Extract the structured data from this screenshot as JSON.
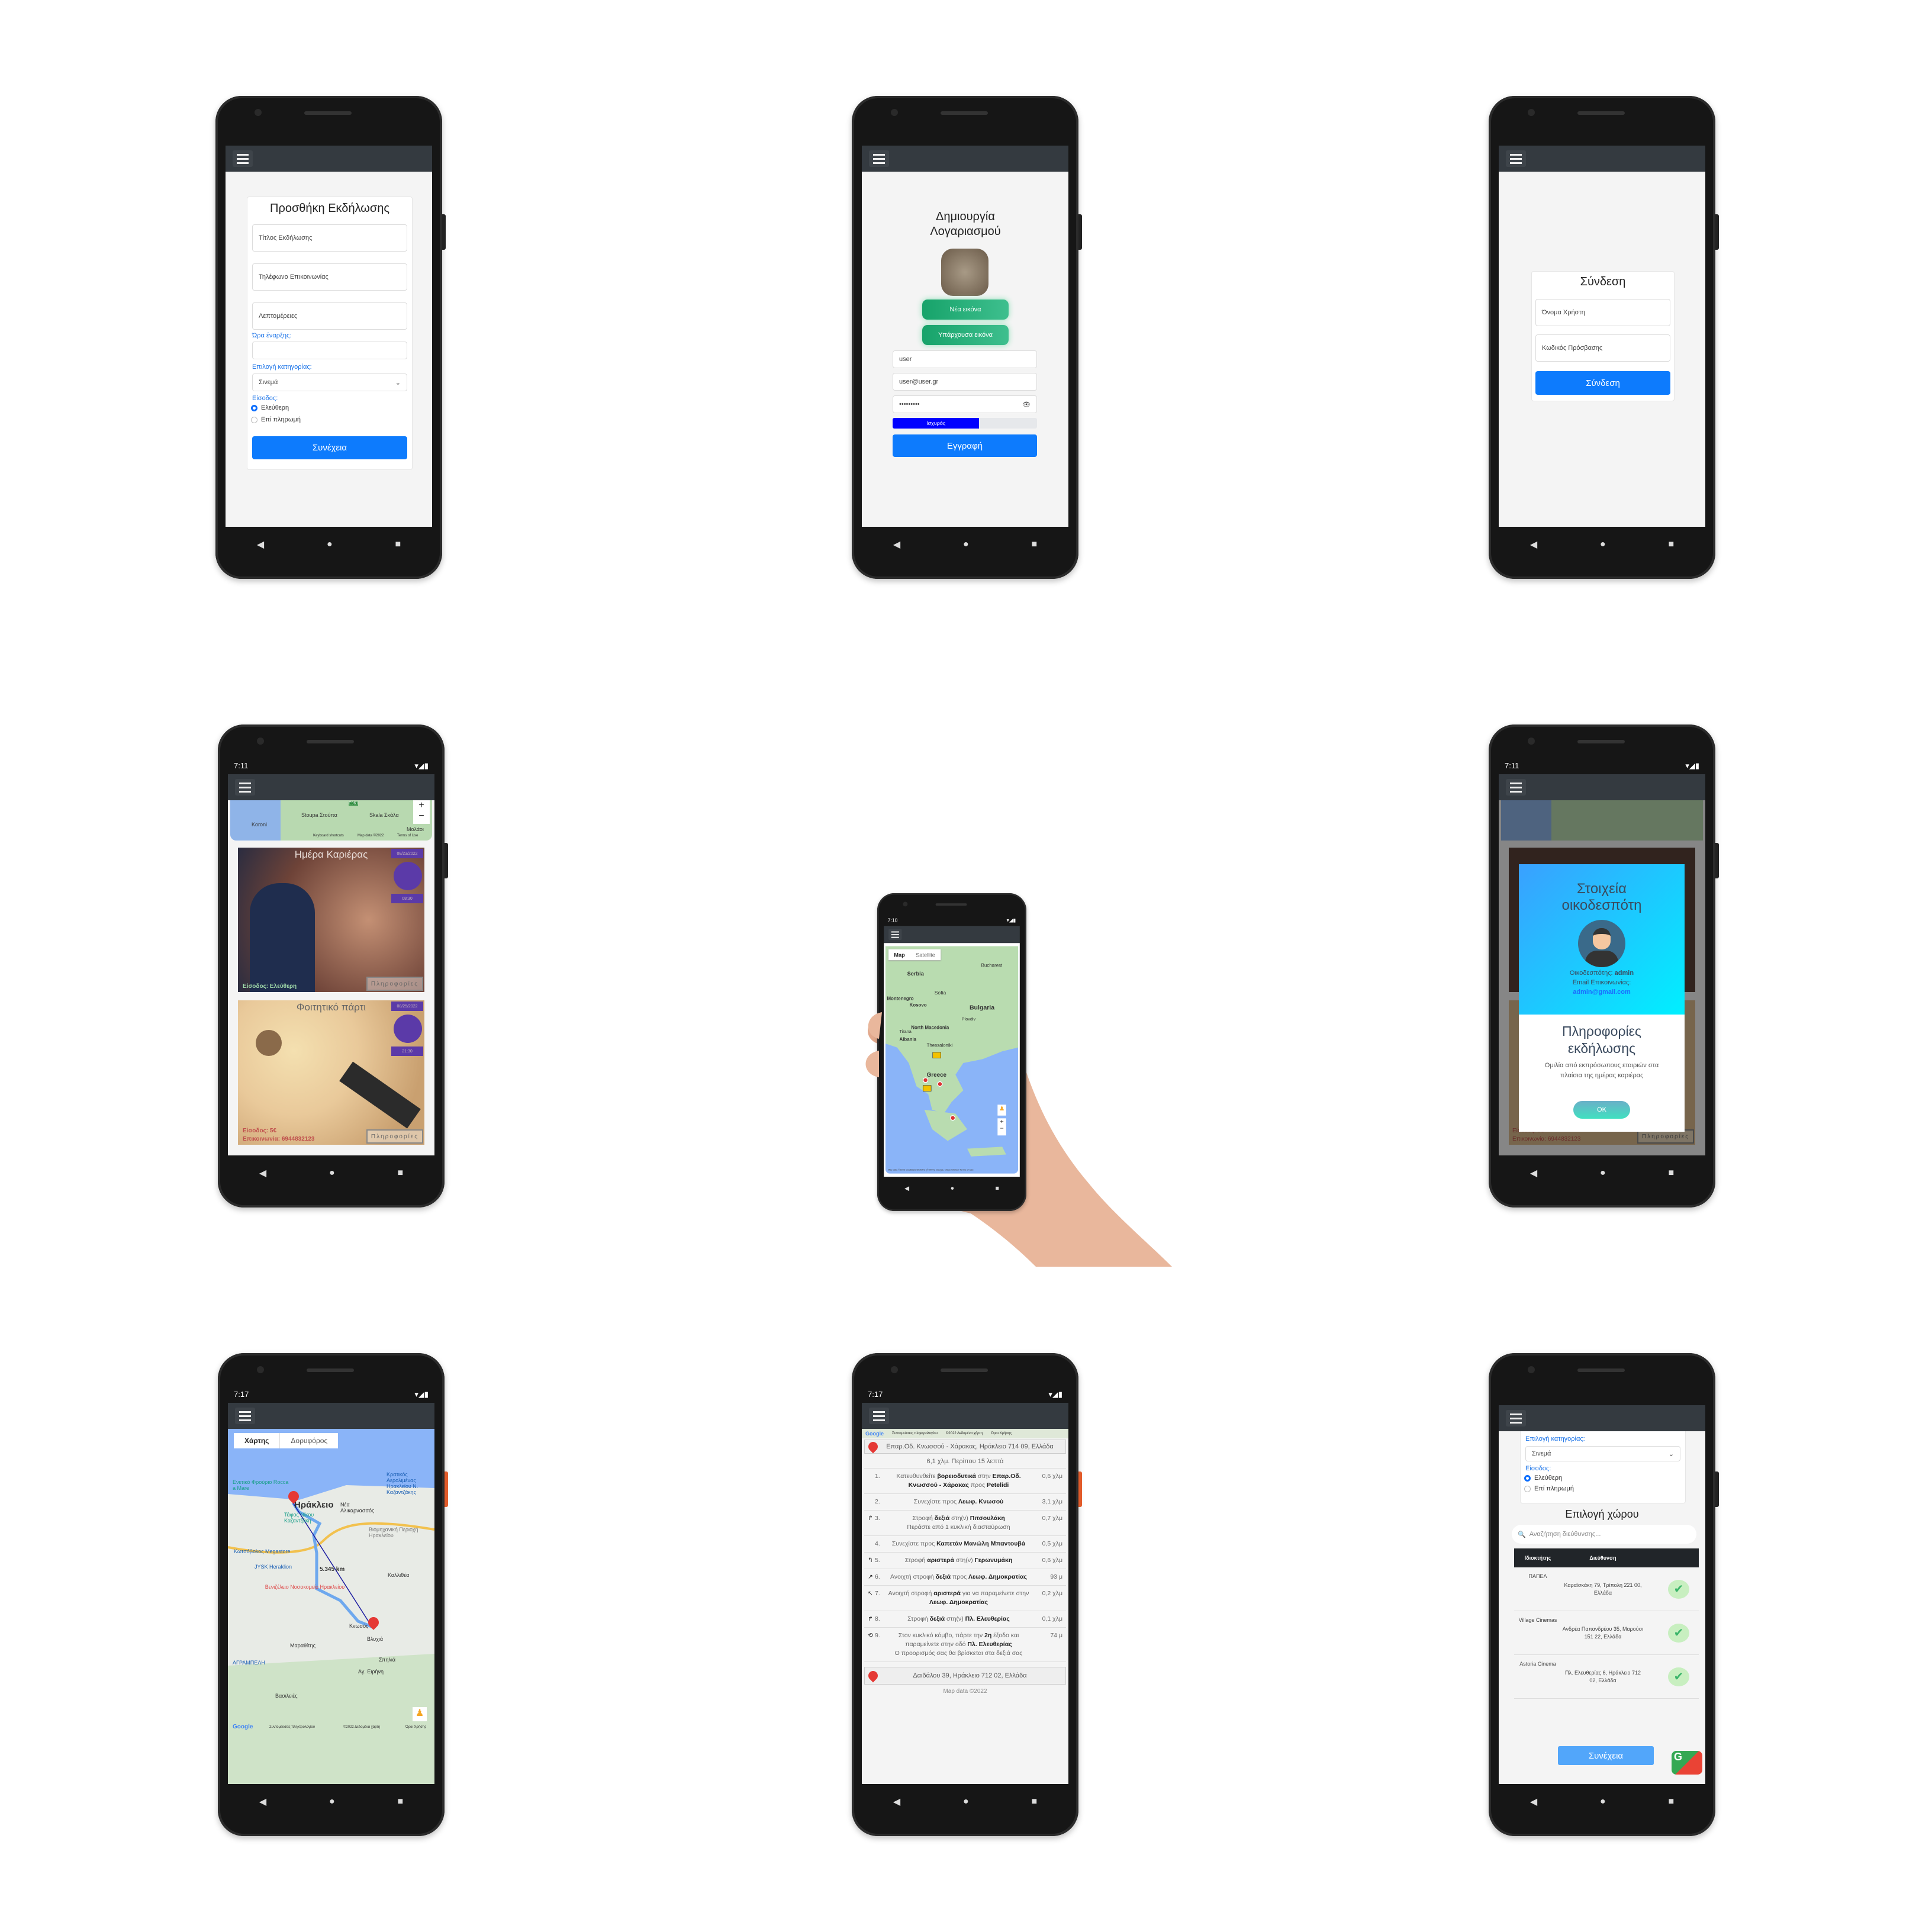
{
  "nav_buttons": {
    "back": "◀",
    "home": "●",
    "recents": "■"
  },
  "add_event": {
    "title": "Προσθήκη Εκδήλωσης",
    "title_placeholder": "Τίτλος Εκδήλωσης",
    "phone_placeholder": "Τηλέφωνο Επικοινωνίας",
    "details_placeholder": "Λεπτομέρειες",
    "start_time_label": "Ώρα έναρξης:",
    "category_label": "Επιλογή κατηγορίας:",
    "category_value": "Σινεμά",
    "entry_label": "Είσοδος:",
    "entry_options": [
      "Ελεύθερη",
      "Επί πληρωμή"
    ],
    "entry_selected": "Ελεύθερη",
    "continue_label": "Συνέχεια"
  },
  "register": {
    "title": "Δημιουργία Λογαριασμού",
    "new_image_label": "Νέα εικόνα",
    "existing_image_label": "Υπάρχουσα εικόνα",
    "username_value": "user",
    "email_value": "user@user.gr",
    "password_value": "•••••••••",
    "strength_label": "Ισχυρός",
    "strength_percent": 60,
    "submit_label": "Εγγραφή"
  },
  "login": {
    "title": "Σύνδεση",
    "username_placeholder": "Όνομα Χρήστη",
    "password_placeholder": "Κωδικός Πρόσβασης",
    "submit_label": "Σύνδεση"
  },
  "events_list": {
    "status_time": "7:11",
    "map_labels": [
      "Stoupa Στούπα",
      "Skala Σκάλα",
      "Koroni",
      "Μολάοι",
      "E961"
    ],
    "map_footer": [
      "Keyboard shortcuts",
      "Map data ©2022",
      "Terms of Use"
    ],
    "events": [
      {
        "title": "Ημέρα Καριέρας",
        "date": "08/23/2022",
        "time": "08:30",
        "entry": "Είσοδος: Ελεύθερη",
        "contact": "",
        "info_label": "Πληροφορίες"
      },
      {
        "title": "Φοιτητικό πάρτι",
        "date": "08/25/2022",
        "time": "21:30",
        "entry": "Είσοδος: 5€",
        "contact": "Επικοινωνία: 6944832123",
        "info_label": "Πληροφορίες"
      }
    ]
  },
  "map_overview": {
    "status_time": "7:10",
    "map_type_tabs": [
      "Map",
      "Satellite"
    ],
    "active_tab": "Map",
    "labels": [
      "Serbia",
      "Bucharest",
      "Sofia",
      "Kosovo",
      "Montenegro",
      "Bulgaria",
      "North Macedonia",
      "Albania",
      "Thessaloniki",
      "Greece",
      "Tirana",
      "Plovdiv"
    ],
    "footer": "Map data ©2022 GeoBasis-DE/BKG (©2009), Google, Mapa GISrael   Terms of Use"
  },
  "host_info": {
    "status_time": "7:11",
    "title": "Στοιχεία οικοδεσπότη",
    "host_label": "Οικοδεσπότης:",
    "host_name": "admin",
    "email_label": "Email Επικοινωνίας:",
    "email": "admin@gmail.com",
    "info_title": "Πληροφορίες εκδήλωσης",
    "description": "Ομιλία από εκπρόσωπους εταιριών στα πλαίσια της ημέρας καριέρας",
    "ok_label": "OK",
    "bg_entry": "Είσοδος: 5€",
    "bg_contact": "Επικοινωνία: 6944832123",
    "bg_info_label": "Πληροφορίες"
  },
  "route_map": {
    "status_time": "7:17",
    "map_type_tabs": [
      "Χάρτης",
      "Δορυφόρος"
    ],
    "active_tab": "Χάρτης",
    "distance_label": "5.345 km",
    "labels": [
      "Ηράκλειο",
      "Νέα Αλικαρνασσός",
      "Ενετικό Φρούριο Rocca a Mare",
      "Κρατικός Αερολιμένας Ηρακλείου Ν. Καζαντζάκης",
      "Τάφος Νίκου Καζαντζάκη",
      "Κωτσόβολος Megastore",
      "JYSK Heraklion",
      "Βενιζέλειο Νοσοκομείο Ηρακλείου",
      "Βιομηχανική Περιοχή Ηρακλείου",
      "Καλλιθέα",
      "Κνωσός",
      "Βλυχιά",
      "Μαραθίτης",
      "Σπηλιά",
      "Αγ. Ειρήνη",
      "ΑΓΡΑΜΠΕΛΗ",
      "Βασιλειές"
    ],
    "footer": [
      "Συντομεύσεις πληκτρολογίου",
      "©2022 Δεδομένα χάρτη",
      "Όροι Χρήσης"
    ]
  },
  "directions": {
    "status_time": "7:17",
    "map_footer": [
      "Συντομεύσεις πληκτρολογίου",
      "©2022 Δεδομένα χάρτη",
      "Όροι Χρήσης"
    ],
    "start_address": "Επαρ.Οδ. Κνωσσού - Χάρακας, Ηράκλειο 714 09, Ελλάδα",
    "summary": "6,1 χλμ. Περίπου 15 λεπτά",
    "steps": [
      {
        "icon": "",
        "num": "1.",
        "html": "Κατευθυνθείτε <b>βορειοδυτικά</b> στην <b>Επαρ.Οδ. Κνωσσού - Χάρακας</b> προς <b>Petelidi</b>",
        "dist": "0,6 χλμ"
      },
      {
        "icon": "",
        "num": "2.",
        "html": "Συνεχίστε προς <b>Λεωφ. Κνωσού</b>",
        "dist": "3,1 χλμ"
      },
      {
        "icon": "↱",
        "num": "3.",
        "html": "Στροφή <b>δεξιά</b> στη(ν) <b>Πιτσουλάκη</b><br>Περάστε από 1 κυκλική διασταύρωση",
        "dist": "0,7 χλμ"
      },
      {
        "icon": "",
        "num": "4.",
        "html": "Συνεχίστε προς <b>Καπετάν Μανώλη Μπαντουβά</b>",
        "dist": "0,5 χλμ"
      },
      {
        "icon": "↰",
        "num": "5.",
        "html": "Στροφή <b>αριστερά</b> στη(ν) <b>Γερωνυμάκη</b>",
        "dist": "0,6 χλμ"
      },
      {
        "icon": "↗",
        "num": "6.",
        "html": "Ανοιχτή στροφή <b>δεξιά</b> προς <b>Λεωφ. Δημοκρατίας</b>",
        "dist": "93 μ"
      },
      {
        "icon": "↖",
        "num": "7.",
        "html": "Ανοιχτή στροφή <b>αριστερά</b> για να παραμείνετε στην <b>Λεωφ. Δημοκρατίας</b>",
        "dist": "0,2 χλμ"
      },
      {
        "icon": "↱",
        "num": "8.",
        "html": "Στροφή <b>δεξιά</b> στη(ν) <b>Πλ. Ελευθερίας</b>",
        "dist": "0,1 χλμ"
      },
      {
        "icon": "⟲",
        "num": "9.",
        "html": "Στον κυκλικό κόμβο, πάρτε την <b>2η</b> έξοδο και παραμείνετε στην οδό <b>Πλ. Ελευθερίας</b><br>Ο προορισμός σας θα βρίσκεται στα δεξιά σας",
        "dist": "74 μ"
      }
    ],
    "end_address": "Δαιδάλου 39, Ηράκλειο 712 02, Ελλάδα",
    "map_data": "Map data ©2022"
  },
  "venue_select": {
    "category_label": "Επιλογή κατηγορίας:",
    "category_value": "Σινεμά",
    "entry_label": "Είσοδος:",
    "entry_options": [
      "Ελεύθερη",
      "Επί πληρωμή"
    ],
    "title": "Επιλογή χώρου",
    "search_placeholder": "Αναζήτηση διεύθυνσης...",
    "columns": [
      "Ιδιοκτήτης",
      "Διεύθυνση"
    ],
    "rows": [
      {
        "owner": "ΠΑΠΕΛ",
        "address": "Καραϊσκάκη 79, Τρίπολη 221 00, Ελλάδα"
      },
      {
        "owner": "Village Cinemas",
        "address": "Ανδρέα Παπανδρέου 35, Μαρούσι 151 22, Ελλάδα"
      },
      {
        "owner": "Astoria Cinema",
        "address": "Πλ. Ελευθερίας 6, Ηράκλειο 712 02, Ελλάδα"
      }
    ],
    "continue_label": "Συνέχεια"
  },
  "colors": {
    "primary": "#0d7bfd",
    "toolbar": "#343a40",
    "success": "#1aa56b",
    "strength": "#0000ff"
  }
}
